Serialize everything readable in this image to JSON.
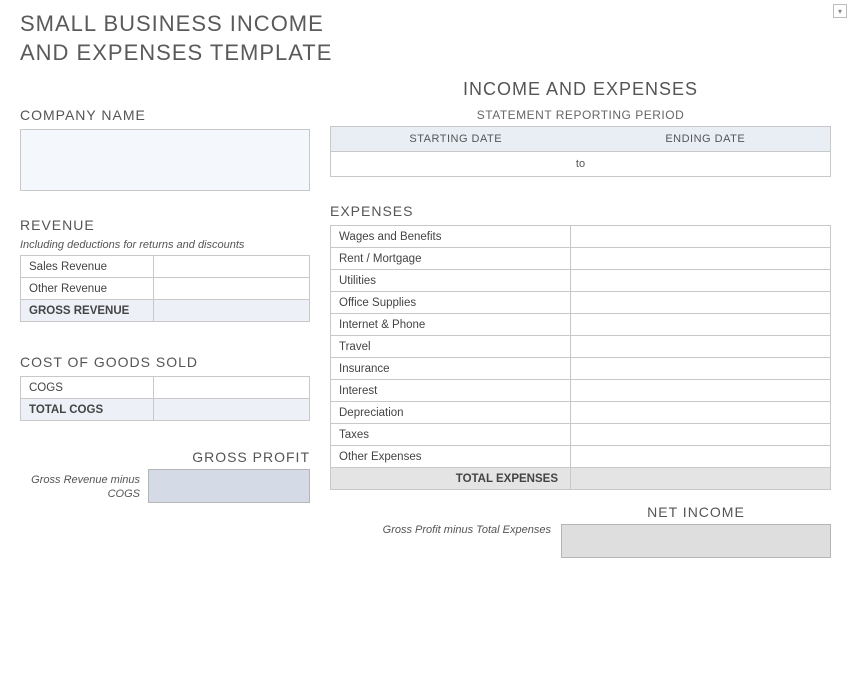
{
  "title_line1": "SMALL BUSINESS INCOME",
  "title_line2": "AND EXPENSES TEMPLATE",
  "header": {
    "income_expenses": "INCOME AND EXPENSES",
    "company_name_label": "COMPANY NAME",
    "reporting_period_label": "STATEMENT REPORTING PERIOD",
    "starting_date_label": "STARTING DATE",
    "ending_date_label": "ENDING DATE",
    "to_label": "to"
  },
  "revenue": {
    "heading": "REVENUE",
    "note": "Including deductions for returns and discounts",
    "rows": {
      "sales": "Sales Revenue",
      "other": "Other Revenue",
      "gross": "GROSS REVENUE"
    }
  },
  "cogs": {
    "heading": "COST OF GOODS SOLD",
    "rows": {
      "cogs": "COGS",
      "total": "TOTAL COGS"
    }
  },
  "gross_profit": {
    "heading": "GROSS PROFIT",
    "note": "Gross Revenue minus COGS"
  },
  "expenses": {
    "heading": "EXPENSES",
    "rows": {
      "wages": "Wages and Benefits",
      "rent": "Rent / Mortgage",
      "utilities": "Utilities",
      "office": "Office Supplies",
      "internet": "Internet & Phone",
      "travel": "Travel",
      "insurance": "Insurance",
      "interest": "Interest",
      "depreciation": "Depreciation",
      "taxes": "Taxes",
      "other": "Other Expenses"
    },
    "total_label": "TOTAL EXPENSES"
  },
  "net_income": {
    "heading": "NET INCOME",
    "note": "Gross Profit minus Total Expenses"
  }
}
